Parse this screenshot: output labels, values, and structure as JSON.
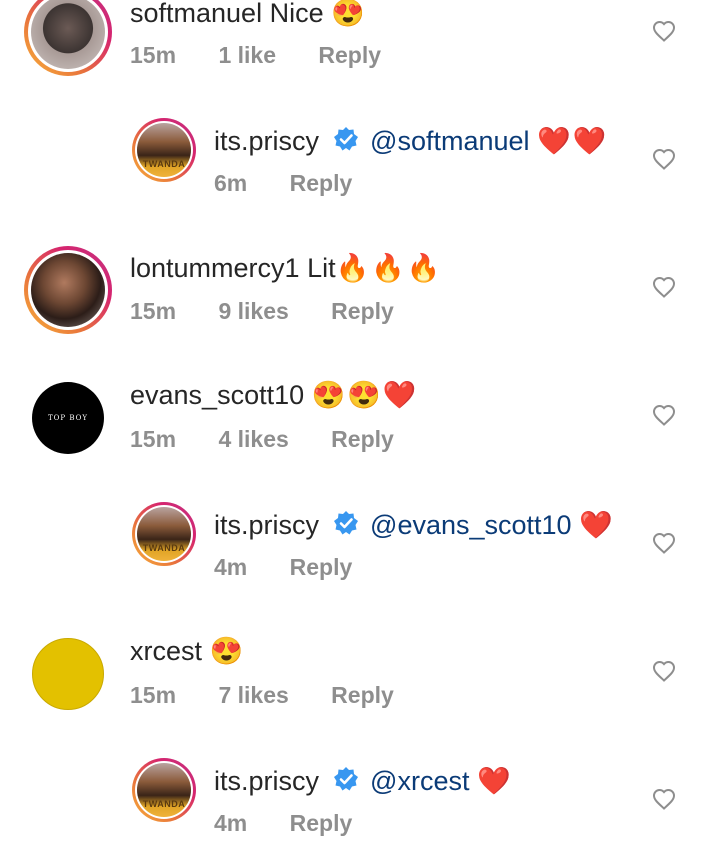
{
  "comments": [
    {
      "user": "softmanuel",
      "text": "Nice",
      "emoji": "😍",
      "time": "15m",
      "likes": "1 like",
      "reply": "Reply"
    },
    {
      "user": "its.priscy",
      "mention": "@softmanuel",
      "emoji": "❤️❤️",
      "time": "6m",
      "reply": "Reply",
      "avatar_text": "TWANDA"
    },
    {
      "user": "lontummercy1",
      "text": "Lit",
      "emoji": "🔥🔥🔥",
      "time": "15m",
      "likes": "9 likes",
      "reply": "Reply"
    },
    {
      "user": "evans_scott10",
      "emoji": "😍😍❤️",
      "time": "15m",
      "likes": "4 likes",
      "reply": "Reply",
      "avatar_text": "TOP BOY"
    },
    {
      "user": "its.priscy",
      "mention": "@evans_scott10",
      "emoji": "❤️",
      "time": "4m",
      "reply": "Reply",
      "avatar_text": "TWANDA"
    },
    {
      "user": "xrcest",
      "emoji": "😍",
      "time": "15m",
      "likes": "7 likes",
      "reply": "Reply"
    },
    {
      "user": "its.priscy",
      "mention": "@xrcest",
      "emoji": "❤️",
      "time": "4m",
      "reply": "Reply",
      "avatar_text": "TWANDA"
    }
  ],
  "colors": {
    "mention": "#0b3b77",
    "meta": "#8e8e8e",
    "verified": "#3897f0",
    "heart_emoji": "#e0557f"
  }
}
